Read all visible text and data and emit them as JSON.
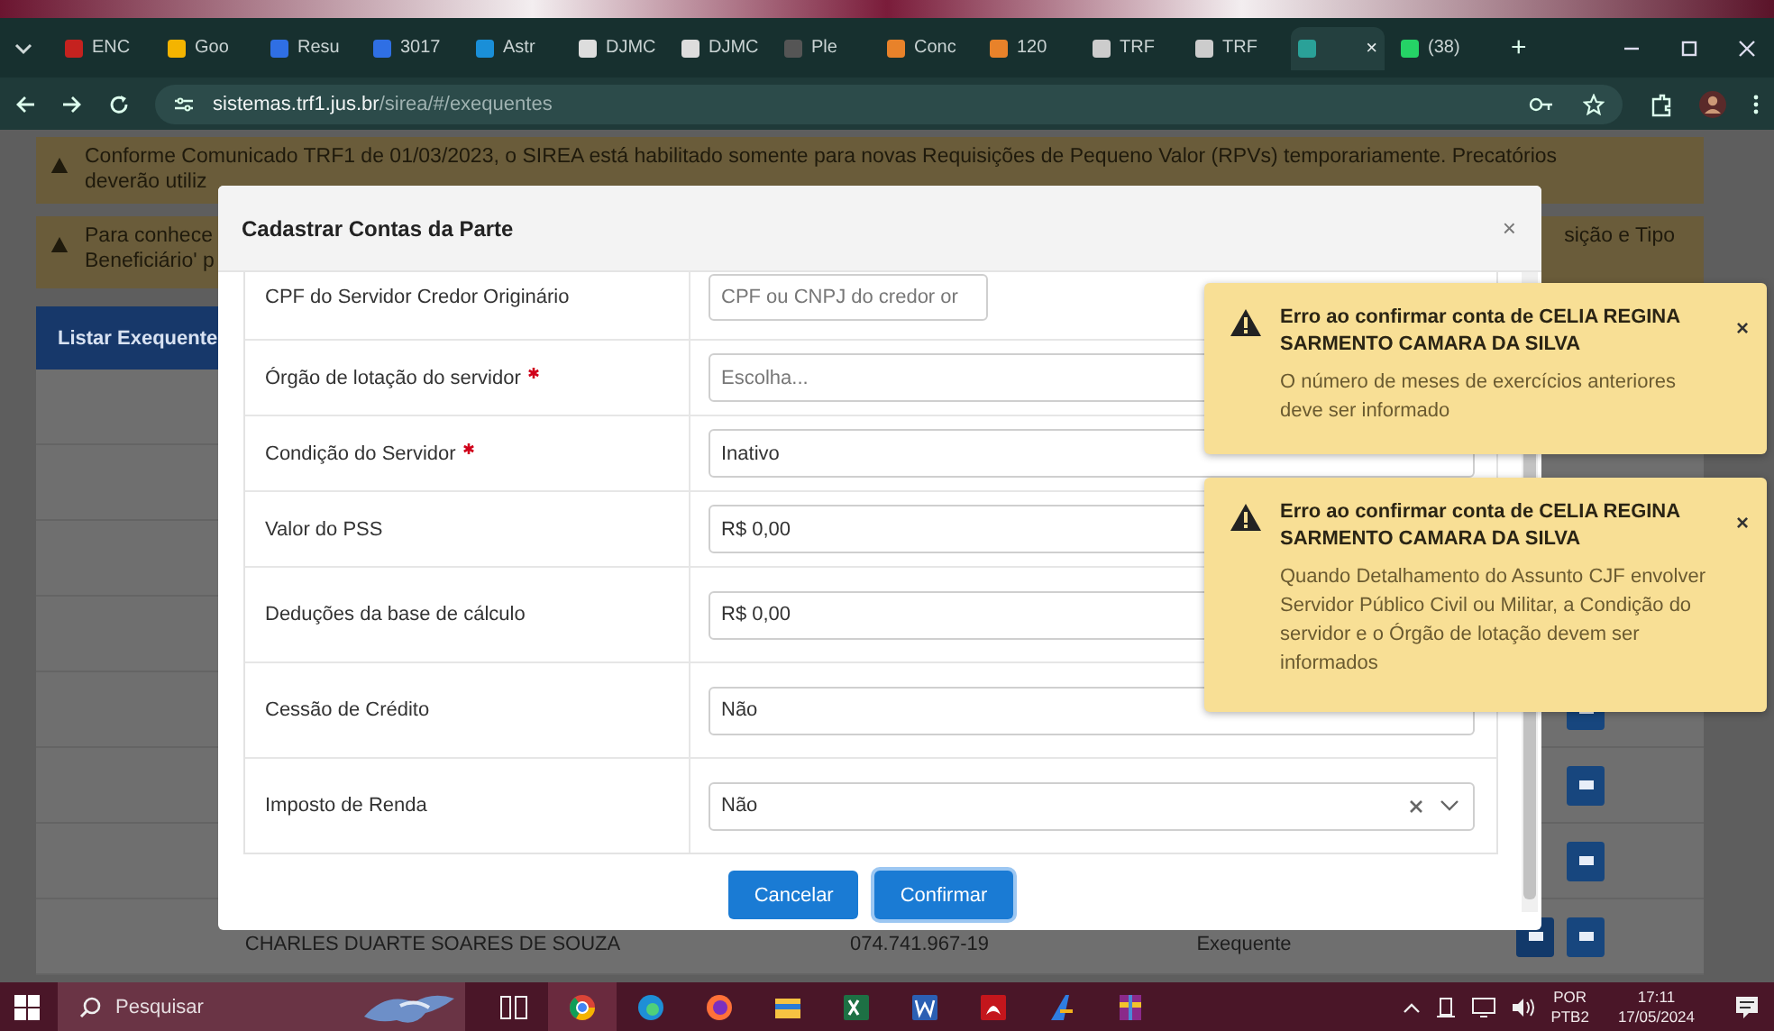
{
  "browser": {
    "tabs": [
      {
        "label": "ENC",
        "selected": false
      },
      {
        "label": "Goo",
        "selected": false
      },
      {
        "label": "Resu",
        "selected": false
      },
      {
        "label": "3017",
        "selected": false
      },
      {
        "label": "Astr",
        "selected": false
      },
      {
        "label": "DJMC",
        "selected": false
      },
      {
        "label": "DJMC",
        "selected": false
      },
      {
        "label": "Ple",
        "selected": false
      },
      {
        "label": "Conc",
        "selected": false
      },
      {
        "label": "120",
        "selected": false
      },
      {
        "label": "TRF",
        "selected": false
      },
      {
        "label": "TRF",
        "selected": false
      },
      {
        "selected": true,
        "close": "×"
      },
      {
        "label": "(38)",
        "selected": false
      }
    ],
    "new_tab": "+",
    "address": {
      "host": "sistemas.trf1.jus.br",
      "path": "/sirea/#/exequentes"
    }
  },
  "page": {
    "notices": [
      {
        "lines": [
          "Conforme Comunicado TRF1 de 01/03/2023, o SIREA está habilitado somente para novas Requisições de Pequeno Valor (RPVs) temporariamente. Precatórios",
          "deverão utiliz"
        ]
      },
      {
        "lines": [
          "Para conhece",
          "Beneficiário' p"
        ],
        "trailing": "sição e Tipo"
      }
    ],
    "list_header": "Listar Exequente",
    "table": {
      "rows": [
        {
          "cells": [],
          "actions": []
        },
        {
          "cells": [],
          "actions": []
        },
        {
          "cells": [],
          "actions": []
        },
        {
          "cells": [],
          "actions": []
        },
        {
          "cells": [],
          "actions": [
            {
              "kind": "icon_button"
            }
          ]
        },
        {
          "cells": [],
          "actions": [
            {
              "kind": "icon_button"
            }
          ]
        },
        {
          "cells": [],
          "actions": [
            {
              "kind": "icon_button"
            }
          ]
        },
        {
          "cells": [
            "CHARLES DUARTE SOARES DE SOUZA",
            "074.741.967-19",
            "Exequente"
          ],
          "actions": [
            {
              "kind": "icon_button"
            },
            {
              "kind": "icon_button"
            }
          ]
        }
      ]
    }
  },
  "modal": {
    "title": "Cadastrar Contas da Parte",
    "close": "×",
    "rows": [
      {
        "label": "CPF do Servidor Credor Originário",
        "required": false,
        "field": {
          "kind": "input",
          "placeholder": "CPF ou CNPJ do credor or",
          "narrow": true
        }
      },
      {
        "label": "Órgão de lotação do servidor",
        "required": true,
        "field": {
          "kind": "select",
          "placeholder": "Escolha...",
          "clearable": false
        }
      },
      {
        "label": "Condição do Servidor",
        "required": true,
        "field": {
          "kind": "select",
          "value": "Inativo",
          "clearable": false
        }
      },
      {
        "label": "Valor do PSS",
        "required": false,
        "field": {
          "kind": "input",
          "value": "R$ 0,00"
        }
      },
      {
        "label": "Deduções da base de cálculo",
        "required": false,
        "field": {
          "kind": "input",
          "value": "R$ 0,00"
        }
      },
      {
        "label": "Cessão de Crédito",
        "required": false,
        "field": {
          "kind": "select",
          "value": "Não",
          "clearable": false
        }
      },
      {
        "label": "Imposto de Renda",
        "required": false,
        "field": {
          "kind": "select",
          "value": "Não",
          "clearable": true
        }
      }
    ],
    "buttons": [
      {
        "label": "Cancelar",
        "focused": false
      },
      {
        "label": "Confirmar",
        "focused": true
      }
    ]
  },
  "toasts": [
    {
      "title": "Erro ao confirmar conta de CELIA REGINA SARMENTO CAMARA DA SILVA",
      "message": "O número de meses de exercícios anteriores deve ser informado",
      "close": "×"
    },
    {
      "title": "Erro ao confirmar conta de CELIA REGINA SARMENTO CAMARA DA SILVA",
      "message": "Quando Detalhamento do Assunto CJF envolver Servidor Público Civil ou Militar, a Condição do servidor e o Órgão de lotação devem ser informados",
      "close": "×"
    }
  ],
  "taskbar": {
    "search": "Pesquisar",
    "language": [
      "POR",
      "PTB2"
    ],
    "clock": [
      "17:11",
      "17/05/2024"
    ]
  }
}
